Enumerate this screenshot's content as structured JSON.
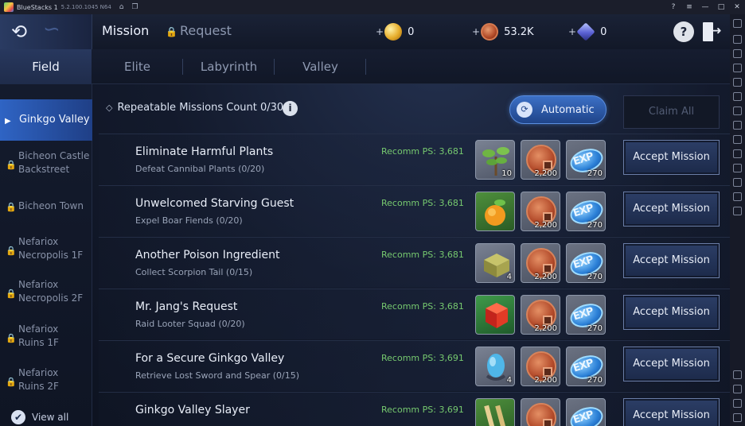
{
  "window": {
    "title": "BlueStacks 1",
    "version": "5.2.100.1045 N64",
    "controls": [
      "?",
      "≡",
      "—",
      "□",
      "✕"
    ]
  },
  "header": {
    "tabs": {
      "mission": "Mission",
      "request": "Request"
    },
    "currencies": {
      "gold": "0",
      "coin": "53.2K",
      "crystal": "0"
    },
    "plus": "+",
    "help_label": "?"
  },
  "categories": [
    "Field",
    "Elite",
    "Labyrinth",
    "Valley"
  ],
  "regions": {
    "active": "Ginkgo Valley",
    "list": [
      "Bicheon Castle Backstreet",
      "Bicheon Town",
      "Nefariox Necropolis 1F",
      "Nefariox Necropolis 2F",
      "Nefariox Ruins 1F",
      "Nefariox Ruins 2F"
    ],
    "view_all": "View all"
  },
  "missions_header": {
    "repeatable": "Repeatable Missions Count 0/30",
    "info": "i",
    "automatic": "Automatic",
    "claim_all": "Claim All"
  },
  "missions": [
    {
      "title": "Eliminate Harmful Plants",
      "sub": "Defeat Cannibal Plants (0/20)",
      "ps": "Recomm PS: 3,681",
      "item_qty": "10",
      "coin_qty": "2,200",
      "exp_qty": "270",
      "accept": "Accept Mission",
      "item_icon": "plant-icon"
    },
    {
      "title": "Unwelcomed Starving Guest",
      "sub": "Expel Boar Fiends (0/20)",
      "ps": "Recomm PS: 3,681",
      "item_qty": "",
      "coin_qty": "2,200",
      "exp_qty": "270",
      "accept": "Accept Mission",
      "item_icon": "fruit-icon"
    },
    {
      "title": "Another Poison Ingredient",
      "sub": "Collect Scorpion Tail (0/15)",
      "ps": "Recomm PS: 3,681",
      "item_qty": "4",
      "coin_qty": "2,200",
      "exp_qty": "270",
      "accept": "Accept Mission",
      "item_icon": "box-icon"
    },
    {
      "title": "Mr. Jang's Request",
      "sub": "Raid Looter Squad (0/20)",
      "ps": "Recomm PS: 3,681",
      "item_qty": "",
      "coin_qty": "2,200",
      "exp_qty": "270",
      "accept": "Accept Mission",
      "item_icon": "red-cube-icon"
    },
    {
      "title": "For a Secure Ginkgo Valley",
      "sub": "Retrieve Lost Sword and Spear (0/15)",
      "ps": "Recomm PS: 3,691",
      "item_qty": "4",
      "coin_qty": "2,200",
      "exp_qty": "270",
      "accept": "Accept Mission",
      "item_icon": "blue-gem-icon"
    },
    {
      "title": "Ginkgo Valley Slayer",
      "sub": "",
      "ps": "Recomm PS: 3,691",
      "item_qty": "",
      "coin_qty": "",
      "exp_qty": "",
      "accept": "Accept Mission",
      "item_icon": "scroll-icon"
    }
  ],
  "exp_label": "EXP",
  "colors": {
    "accent": "#2f64c4",
    "recomm_green": "#76c96f"
  }
}
